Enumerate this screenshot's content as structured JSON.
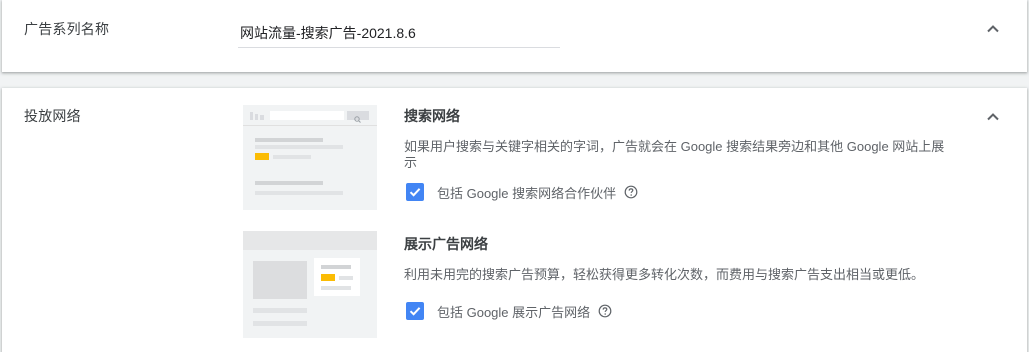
{
  "campaign_name": {
    "label": "广告系列名称",
    "value": "网站流量-搜索广告-2021.8.6"
  },
  "networks": {
    "label": "投放网络",
    "search": {
      "title": "搜索网络",
      "description": "如果用户搜索与关键字相关的字词，广告就会在 Google 搜索结果旁边和其他 Google 网站上展示",
      "checkbox_label": "包括 Google 搜索网络合作伙伴",
      "checked": true
    },
    "display": {
      "title": "展示广告网络",
      "description": "利用未用完的搜索广告预算，轻松获得更多转化次数，而费用与搜索广告支出相当或更低。",
      "checkbox_label": "包括 Google 展示广告网络",
      "checked": true
    }
  },
  "icons": {
    "collapse": "chevron-up-icon",
    "checkbox": "checkmark-icon",
    "help": "help-circle-icon",
    "search": "search-icon"
  },
  "colors": {
    "checkbox": "#4285f4",
    "accent_yellow": "#fbbc04",
    "background": "#f1f3f4"
  }
}
